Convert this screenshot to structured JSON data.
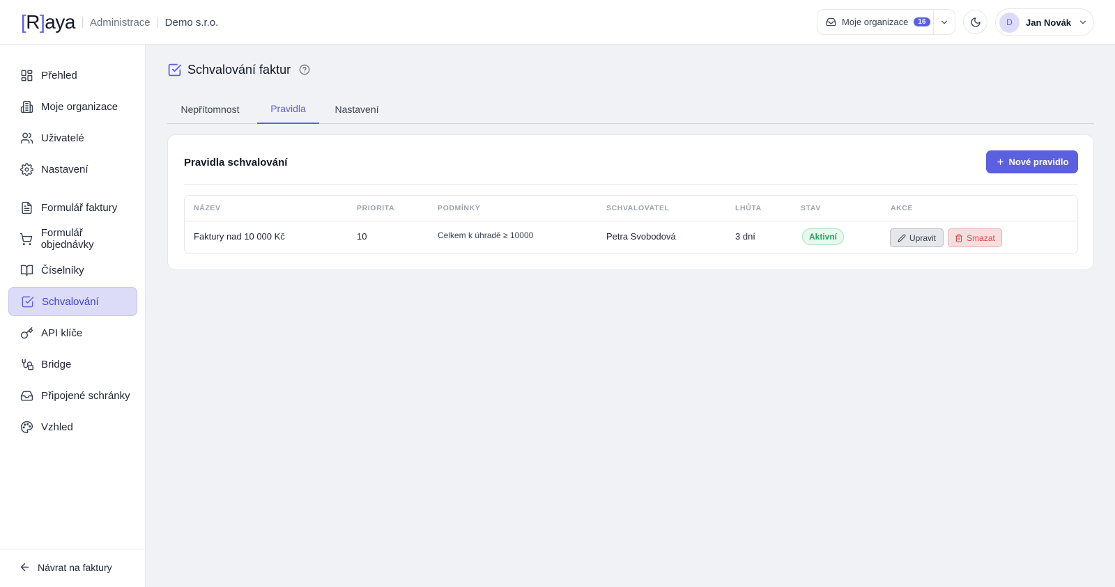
{
  "header": {
    "logo_bracket_open": "[",
    "logo_r": "R",
    "logo_bracket_close": "]",
    "logo_rest": "aya",
    "admin_label": "Administrace",
    "company_name": "Demo s.r.o.",
    "org_selector": {
      "label": "Moje organizace",
      "count": "16"
    },
    "user": {
      "initial": "D",
      "name": "Jan Novák"
    }
  },
  "sidebar": {
    "items": [
      {
        "label": "Přehled",
        "icon": "dashboard-icon"
      },
      {
        "label": "Moje organizace",
        "icon": "building-icon"
      },
      {
        "label": "Uživatelé",
        "icon": "users-icon"
      },
      {
        "label": "Nastavení",
        "icon": "gear-icon"
      },
      {
        "label": "Formulář faktury",
        "icon": "document-icon"
      },
      {
        "label": "Formulář objednávky",
        "icon": "cart-icon"
      },
      {
        "label": "Číselníky",
        "icon": "book-icon"
      },
      {
        "label": "Schvalování",
        "icon": "check-square-icon",
        "active": true
      },
      {
        "label": "API klíče",
        "icon": "key-icon"
      },
      {
        "label": "Bridge",
        "icon": "bridge-icon"
      },
      {
        "label": "Připojené schránky",
        "icon": "inbox-icon"
      },
      {
        "label": "Vzhled",
        "icon": "palette-icon"
      }
    ],
    "back_label": "Návrat na faktury"
  },
  "page": {
    "title": "Schvalování faktur",
    "tabs": [
      {
        "label": "Nepřítomnost"
      },
      {
        "label": "Pravidla",
        "active": true
      },
      {
        "label": "Nastavení"
      }
    ]
  },
  "rules": {
    "title": "Pravidla schvalování",
    "new_button": "Nové pravidlo",
    "columns": [
      "NÁZEV",
      "PRIORITA",
      "PODMÍNKY",
      "SCHVALOVATEL",
      "LHŮTA",
      "STAV",
      "AKCE"
    ],
    "rows": [
      {
        "name": "Faktury nad 10 000 Kč",
        "priority": "10",
        "conditions": "Celkem k úhradě ≥ 10000",
        "approver": "Petra Svobodová",
        "deadline": "3 dní",
        "status": "Aktivní",
        "edit": "Upravit",
        "delete": "Smazat"
      }
    ]
  },
  "colors": {
    "accent": "#5b5fe0",
    "active_bg": "#dcdcf9",
    "status_green": "#23a05a",
    "danger": "#dc4646"
  }
}
